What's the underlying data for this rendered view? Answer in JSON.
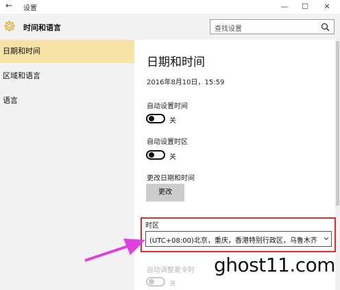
{
  "window": {
    "back_glyph": "←",
    "title": "设置",
    "minimize_glyph": "—",
    "maximize_glyph": "☐",
    "close_glyph": "✕"
  },
  "header": {
    "icon": "gear-icon",
    "title": "时间和语言",
    "search_placeholder": "查找设置",
    "search_icon": "search-icon"
  },
  "sidebar": {
    "items": [
      {
        "label": "日期和时间",
        "active": true
      },
      {
        "label": "区域和语言",
        "active": false
      },
      {
        "label": "语言",
        "active": false
      }
    ]
  },
  "main": {
    "title": "日期和时间",
    "current_datetime": "2016年8月10日，15:59",
    "auto_time": {
      "label": "自动设置时间",
      "state": "关"
    },
    "auto_timezone": {
      "label": "自动设置时区",
      "state": "关"
    },
    "change": {
      "label": "更改日期和时间",
      "button": "更改"
    },
    "timezone": {
      "label": "时区",
      "value": "(UTC+08:00)北京，重庆，香港特别行政区，乌鲁木齐"
    },
    "dst": {
      "label": "自动调整夏令时",
      "state": "关"
    }
  },
  "annotation": {
    "highlight_color": "#e82a2a",
    "arrow_color": "#e040e0"
  },
  "watermark": "ghost11.com",
  "colors": {
    "active_nav": "#f7e3a8",
    "header_bg": "#f2f2f2",
    "button_bg": "#cccccc"
  }
}
